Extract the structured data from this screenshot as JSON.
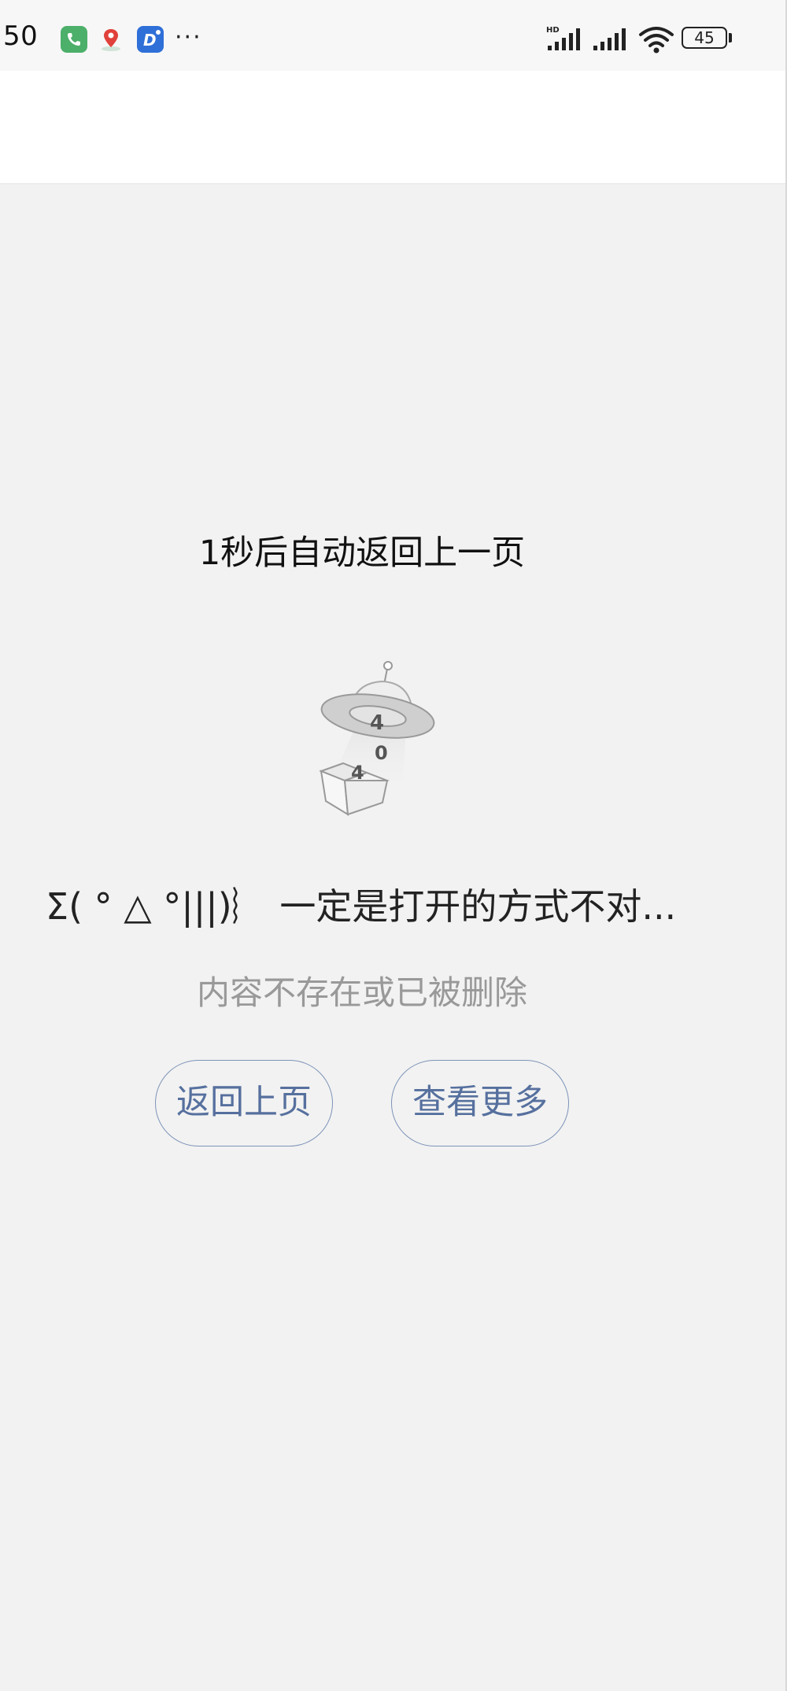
{
  "status_bar": {
    "time": ":50",
    "more_indicator": "···",
    "battery_level": "45",
    "icons": [
      "phone-call-icon",
      "map-pin-icon",
      "d-app-icon",
      "signal-icon",
      "wifi-icon",
      "battery-icon"
    ]
  },
  "page": {
    "countdown_text": "1秒后自动返回上一页",
    "illustration_label": "404",
    "error_title": "Σ( ° △ °|||)︴ 一定是打开的方式不对...",
    "error_subtitle": "内容不存在或已被删除",
    "back_button_label": "返回上页",
    "more_button_label": "查看更多"
  },
  "colors": {
    "background": "#f2f2f2",
    "button_border": "#7d93b8",
    "button_text": "#56709e",
    "subtitle": "#999999"
  }
}
